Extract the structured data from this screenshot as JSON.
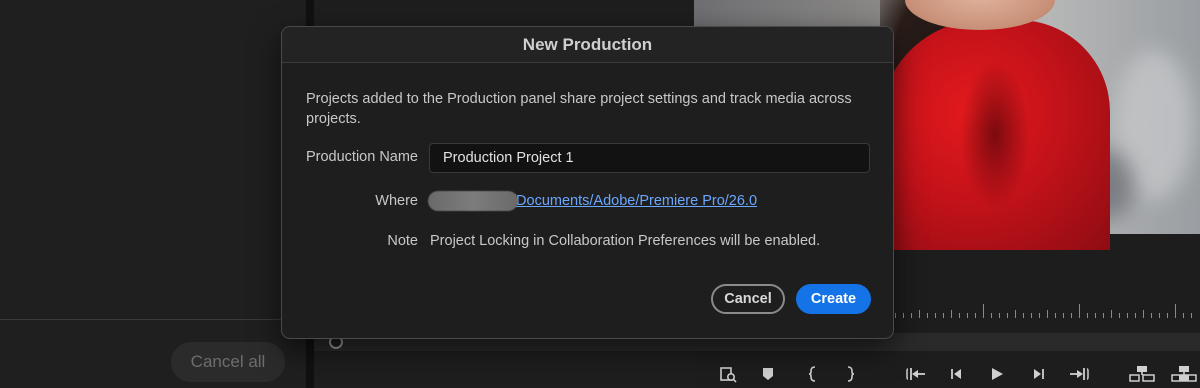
{
  "background": {
    "cancel_all_label": "Cancel all",
    "transport_icons": [
      "search-media-icon",
      "marker-icon",
      "mark-in-icon",
      "mark-out-icon",
      "go-to-in-icon",
      "step-back-icon",
      "play-icon",
      "step-forward-icon",
      "go-to-out-icon",
      "insert-icon",
      "overwrite-icon"
    ]
  },
  "dialog": {
    "title": "New Production",
    "description": "Projects added to the Production panel share project settings and track media across projects.",
    "fields": {
      "name_label": "Production Name",
      "name_value": "Production Project 1",
      "where_label": "Where",
      "where_path": "/Documents/Adobe/Premiere Pro/26.0",
      "note_label": "Note",
      "note_text": "Project Locking in Collaboration Preferences will be enabled."
    },
    "buttons": {
      "cancel": "Cancel",
      "create": "Create"
    }
  },
  "colors": {
    "accent": "#1473e6",
    "link": "#6aa7ff",
    "coat_red": "#d4141a"
  }
}
